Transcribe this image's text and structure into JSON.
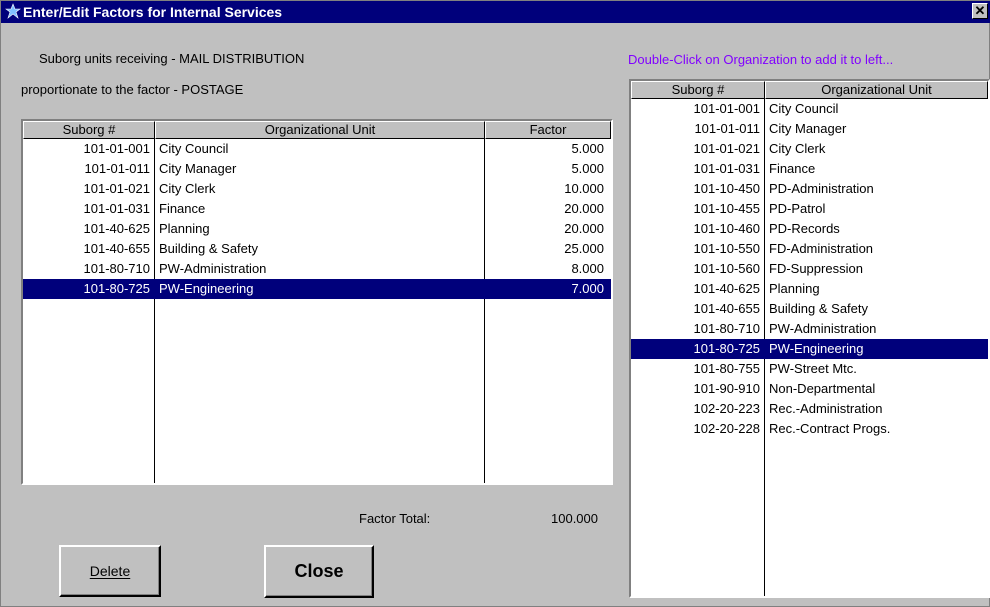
{
  "window": {
    "title": "Enter/Edit Factors for Internal Services",
    "close_glyph": "✕"
  },
  "info": {
    "line1": "Suborg units receiving - MAIL DISTRIBUTION",
    "line2": "proportionate to the factor - POSTAGE",
    "hint": "Double-Click on Organization to add it to left..."
  },
  "left_table": {
    "headers": [
      "Suborg #",
      "Organizational Unit",
      "Factor"
    ],
    "rows": [
      {
        "suborg": "101-01-001",
        "unit": "City Council",
        "factor": "5.000"
      },
      {
        "suborg": "101-01-011",
        "unit": "City Manager",
        "factor": "5.000"
      },
      {
        "suborg": "101-01-021",
        "unit": "City Clerk",
        "factor": "10.000"
      },
      {
        "suborg": "101-01-031",
        "unit": "Finance",
        "factor": "20.000"
      },
      {
        "suborg": "101-40-625",
        "unit": "Planning",
        "factor": "20.000"
      },
      {
        "suborg": "101-40-655",
        "unit": "Building & Safety",
        "factor": "25.000"
      },
      {
        "suborg": "101-80-710",
        "unit": "PW-Administration",
        "factor": "8.000"
      },
      {
        "suborg": "101-80-725",
        "unit": "PW-Engineering",
        "factor": "7.000"
      }
    ],
    "selected_index": 7
  },
  "factor_total": {
    "label": "Factor Total:",
    "value": "100.000"
  },
  "buttons": {
    "delete_label": "Delete",
    "close_label": "Close"
  },
  "right_table": {
    "headers": [
      "Suborg #",
      "Organizational Unit"
    ],
    "rows": [
      {
        "suborg": "101-01-001",
        "unit": "City Council"
      },
      {
        "suborg": "101-01-011",
        "unit": "City Manager"
      },
      {
        "suborg": "101-01-021",
        "unit": "City Clerk"
      },
      {
        "suborg": "101-01-031",
        "unit": "Finance"
      },
      {
        "suborg": "101-10-450",
        "unit": "PD-Administration"
      },
      {
        "suborg": "101-10-455",
        "unit": "PD-Patrol"
      },
      {
        "suborg": "101-10-460",
        "unit": "PD-Records"
      },
      {
        "suborg": "101-10-550",
        "unit": "FD-Administration"
      },
      {
        "suborg": "101-10-560",
        "unit": "FD-Suppression"
      },
      {
        "suborg": "101-40-625",
        "unit": "Planning"
      },
      {
        "suborg": "101-40-655",
        "unit": "Building & Safety"
      },
      {
        "suborg": "101-80-710",
        "unit": "PW-Administration"
      },
      {
        "suborg": "101-80-725",
        "unit": "PW-Engineering"
      },
      {
        "suborg": "101-80-755",
        "unit": "PW-Street Mtc."
      },
      {
        "suborg": "101-90-910",
        "unit": "Non-Departmental"
      },
      {
        "suborg": "102-20-223",
        "unit": "Rec.-Administration"
      },
      {
        "suborg": "102-20-228",
        "unit": "Rec.-Contract Progs."
      }
    ],
    "selected_index": 12
  },
  "colors": {
    "title_bar": "#00007b",
    "selection": "#00007b",
    "hint_text": "#8000ff",
    "window_face": "#c0c0c0"
  },
  "icons": {
    "app": "star-figure-icon",
    "close": "close-icon"
  }
}
